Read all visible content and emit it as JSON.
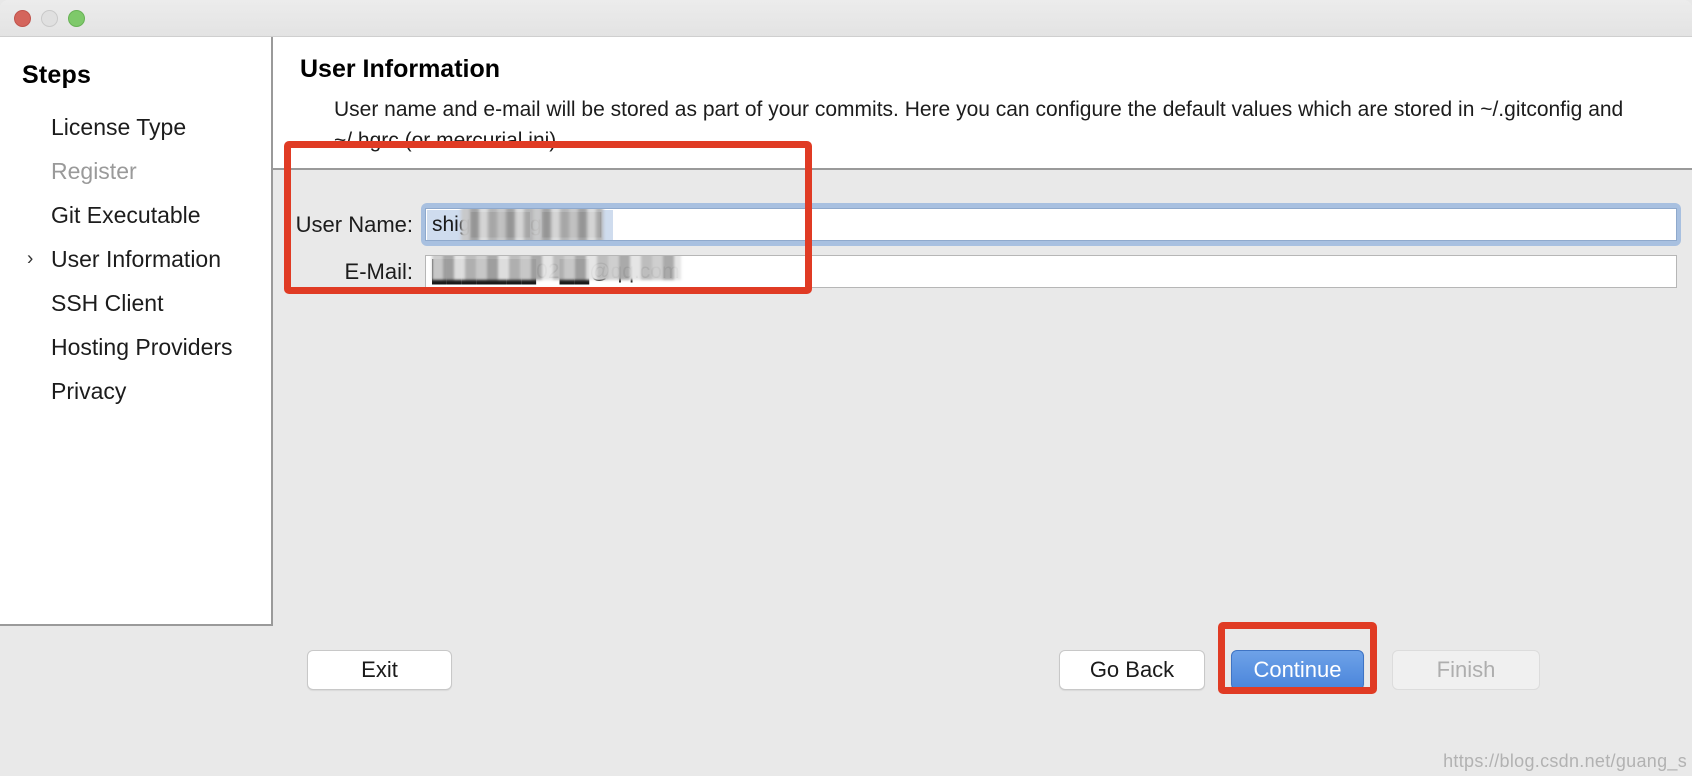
{
  "window": {
    "controls": {
      "close": "close-button",
      "minimize": "minimize-button",
      "zoom": "zoom-button"
    }
  },
  "sidebar": {
    "title": "Steps",
    "items": [
      {
        "label": "License Type",
        "state": "normal",
        "selected": false
      },
      {
        "label": "Register",
        "state": "disabled",
        "selected": false
      },
      {
        "label": "Git Executable",
        "state": "normal",
        "selected": false
      },
      {
        "label": "User Information",
        "state": "normal",
        "selected": true,
        "chevron": "chevron-right-icon"
      },
      {
        "label": "SSH Client",
        "state": "normal",
        "selected": false
      },
      {
        "label": "Hosting Providers",
        "state": "normal",
        "selected": false
      },
      {
        "label": "Privacy",
        "state": "normal",
        "selected": false
      }
    ]
  },
  "main": {
    "title": "User Information",
    "description": "User name and e-mail will be stored as part of your commits. Here you can configure the default values which are stored in ~/.gitconfig and ~/.hgrc (or mercurial.ini).",
    "fields": [
      {
        "label": "User Name:",
        "value": "shig████g████",
        "placeholder": "",
        "focused": true,
        "redacted": true
      },
      {
        "label": "E-Mail:",
        "value": "███████02██@qq.com",
        "placeholder": "",
        "focused": false,
        "redacted": true
      }
    ]
  },
  "buttons": {
    "exit": "Exit",
    "go_back": "Go Back",
    "continue": "Continue",
    "finish": "Finish"
  },
  "annotations": {
    "fields_box": "red-highlight-rectangle",
    "continue_box": "red-highlight-rectangle",
    "accent_red": "#e03b24",
    "accent_blue": "#4a85db"
  },
  "watermark": "https://blog.csdn.net/guang_s"
}
